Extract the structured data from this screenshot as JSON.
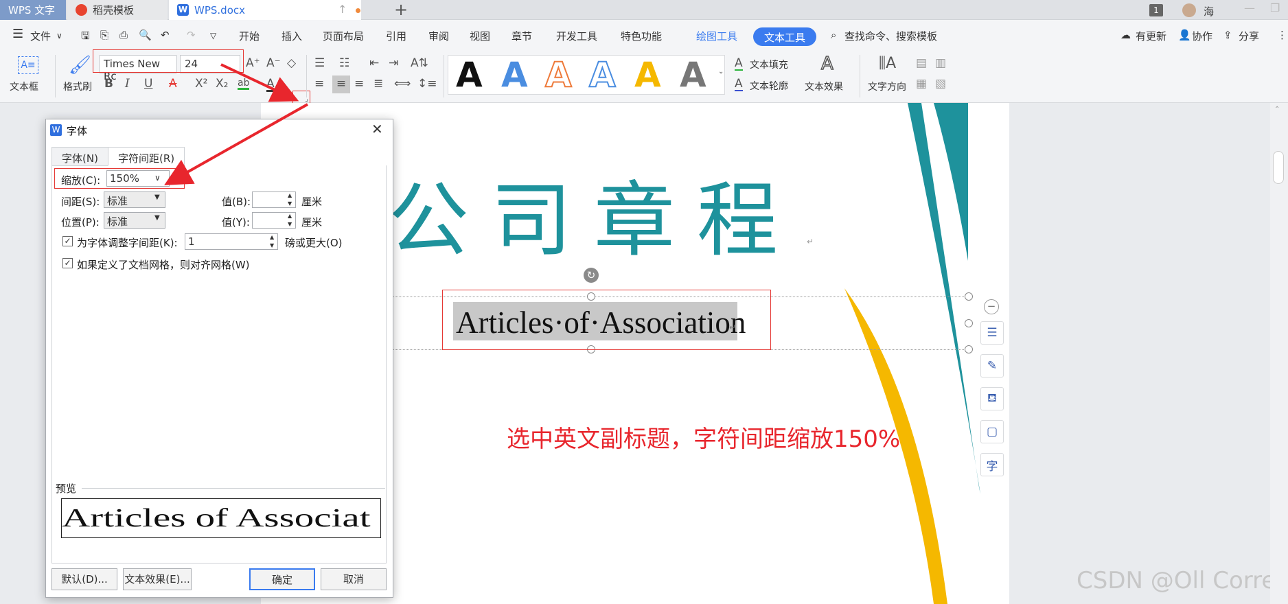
{
  "titlebar": {
    "tabs": [
      {
        "label": "WPS 文字"
      },
      {
        "label": "稻壳模板"
      },
      {
        "label": "WPS.docx"
      }
    ],
    "badge": "1",
    "user": "海"
  },
  "menu": {
    "file": "文件",
    "items": [
      "开始",
      "插入",
      "页面布局",
      "引用",
      "审阅",
      "视图",
      "章节",
      "开发工具",
      "特色功能"
    ],
    "drawing_tools": "绘图工具",
    "text_tools": "文本工具",
    "search": "查找命令、搜索模板",
    "update": "有更新",
    "collab": "协作",
    "share": "分享"
  },
  "ribbon": {
    "textbox": "文本框",
    "format_painter": "格式刷",
    "font_name": "Times New Rc",
    "font_size": "24",
    "text_fill": "文本填充",
    "text_outline": "文本轮廓",
    "text_effect": "文本效果",
    "text_direction": "文字方向"
  },
  "document": {
    "title": "公司章程",
    "subtitle": "Articles·of·Association",
    "note": "选中英文副标题，字符间距缩放150%",
    "watermark": "CSDN @Oll Correct"
  },
  "dialog": {
    "title": "字体",
    "tab_font": "字体(N)",
    "tab_spacing": "字符间距(R)",
    "scale_label": "缩放(C):",
    "scale_value": "150%",
    "spacing_label": "间距(S):",
    "spacing_value": "标准",
    "position_label": "位置(P):",
    "position_value": "标准",
    "value_b_label": "值(B):",
    "value_y_label": "值(Y):",
    "unit": "厘米",
    "kerning_label": "为字体调整字间距(K):",
    "kerning_value": "1",
    "kerning_suffix": "磅或更大(O)",
    "grid_label": "如果定义了文档网格，则对齐网格(W)",
    "preview_label": "预览",
    "preview_text": "Articles of Associat",
    "btn_default": "默认(D)...",
    "btn_effect": "文本效果(E)...",
    "btn_ok": "确定",
    "btn_cancel": "取消"
  },
  "colors": {
    "accent": "#3a7bef",
    "teal": "#1e929c",
    "annotation_red": "#e8262d",
    "gold": "#f5b800"
  }
}
